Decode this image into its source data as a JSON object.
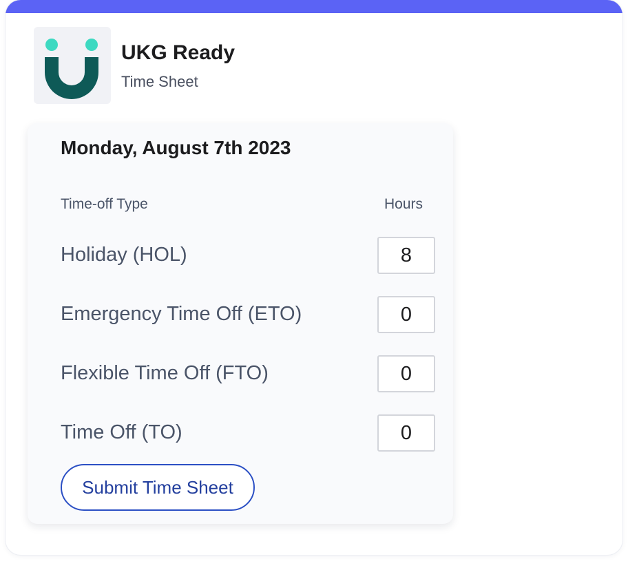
{
  "app": {
    "name": "UKG Ready",
    "subtitle": "Time Sheet",
    "logo_icon": "ukg-smile-logo",
    "accent_color": "#5b63f5",
    "logo_dot_color": "#3dd9c1",
    "logo_smile_color": "#0e5a57"
  },
  "timesheet": {
    "date": "Monday, August 7th 2023",
    "columns": {
      "type": "Time-off Type",
      "hours": "Hours"
    },
    "rows": [
      {
        "label": "Holiday (HOL)",
        "hours": "8"
      },
      {
        "label": "Emergency Time Off (ETO)",
        "hours": "0"
      },
      {
        "label": "Flexible Time Off (FTO)",
        "hours": "0"
      },
      {
        "label": "Time Off (TO)",
        "hours": "0"
      }
    ],
    "submit_label": "Submit Time Sheet",
    "button_color": "#2b4fc4"
  }
}
